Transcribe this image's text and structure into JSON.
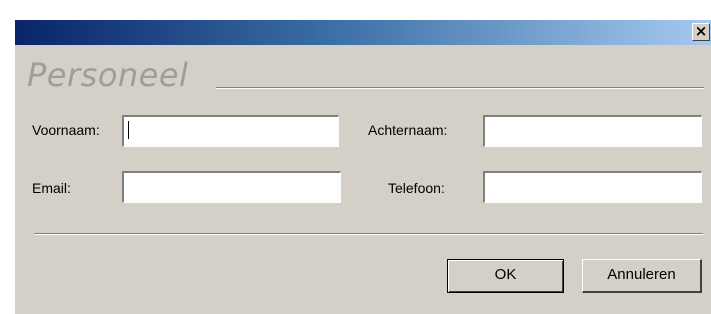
{
  "dialog": {
    "close_glyph": "×",
    "heading": "Personeel"
  },
  "form": {
    "voornaam": {
      "label": "Voornaam:",
      "value": ""
    },
    "achternaam": {
      "label": "Achternaam:",
      "value": ""
    },
    "email": {
      "label": "Email:",
      "value": ""
    },
    "telefoon": {
      "label": "Telefoon:",
      "value": ""
    }
  },
  "buttons": {
    "ok_label": "OK",
    "cancel_label": "Annuleren"
  },
  "colors": {
    "titlebar_start": "#0a246a",
    "titlebar_end": "#a6caf0",
    "dialog_face": "#d4d0c8",
    "heading_text": "#a09c98"
  }
}
